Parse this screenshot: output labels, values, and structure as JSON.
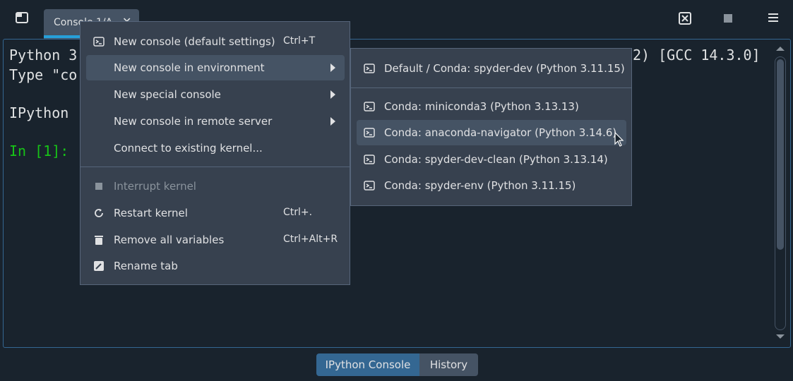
{
  "toolbar": {
    "window_icon": "window-icon",
    "close_icon": "close-console-icon",
    "stop_icon": "stop-icon",
    "menu_icon": "hamburger-menu-icon"
  },
  "tab": {
    "label": "Console 1/A",
    "close": "✕"
  },
  "console": {
    "line1_left": "Python 3",
    "line1_right": "2) [GCC 14.3.0]",
    "line2": "Type \"co",
    "line3": "IPython",
    "prompt": "In [1]:"
  },
  "main_menu": {
    "items": [
      {
        "label": "New console (default settings)",
        "shortcut": "Ctrl+T",
        "icon": "terminal-icon"
      },
      {
        "label": "New console in environment",
        "submenu": true
      },
      {
        "label": "New special console",
        "submenu": true
      },
      {
        "label": "New console in remote server",
        "submenu": true
      },
      {
        "label": "Connect to existing kernel..."
      },
      {
        "label": "Interrupt kernel",
        "disabled": true,
        "icon": "stop-icon"
      },
      {
        "label": "Restart kernel",
        "shortcut": "Ctrl+.",
        "icon": "restart-icon"
      },
      {
        "label": "Remove all variables",
        "shortcut": "Ctrl+Alt+R",
        "icon": "trash-icon"
      },
      {
        "label": "Rename tab",
        "icon": "rename-icon"
      }
    ]
  },
  "env_menu": {
    "items": [
      {
        "label": "Default / Conda: spyder-dev (Python 3.11.15)"
      },
      {
        "label": "Conda: miniconda3 (Python 3.13.13)"
      },
      {
        "label": "Conda: anaconda-navigator (Python 3.14.6)"
      },
      {
        "label": "Conda: spyder-dev-clean (Python 3.13.14)"
      },
      {
        "label": "Conda: spyder-env (Python 3.11.15)"
      }
    ]
  },
  "bottom_tabs": {
    "ipython": "IPython Console",
    "history": "History"
  },
  "colors": {
    "accent": "#26a0da",
    "prompt": "#17c317",
    "menu_bg": "#37414f",
    "highlight": "#455364"
  }
}
